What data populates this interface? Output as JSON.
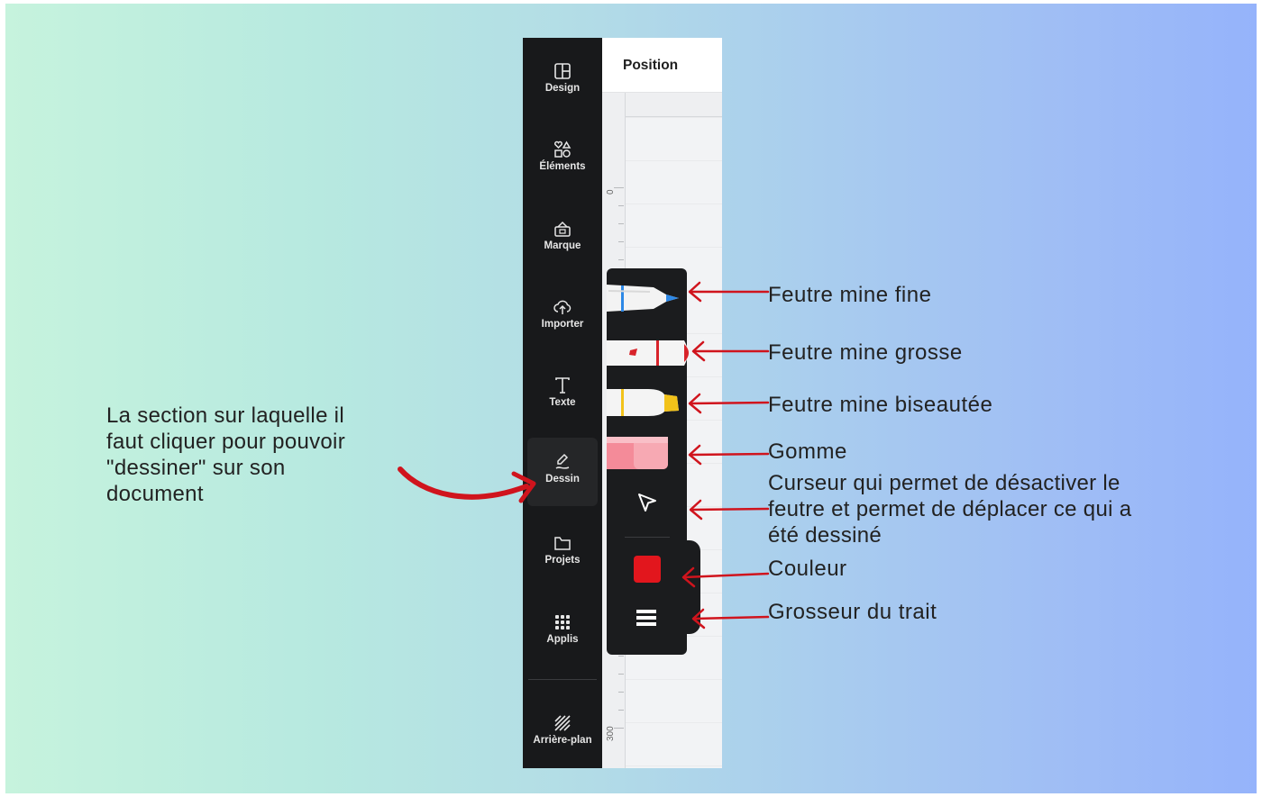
{
  "sidebar": {
    "items": [
      {
        "label": "Design",
        "icon": "layout-icon"
      },
      {
        "label": "Éléments",
        "icon": "shapes-icon"
      },
      {
        "label": "Marque",
        "icon": "brand-icon"
      },
      {
        "label": "Importer",
        "icon": "cloud-upload-icon"
      },
      {
        "label": "Texte",
        "icon": "text-icon"
      },
      {
        "label": "Dessin",
        "icon": "draw-icon",
        "active": true
      },
      {
        "label": "Projets",
        "icon": "folder-icon"
      },
      {
        "label": "Applis",
        "icon": "apps-grid-icon"
      },
      {
        "label": "Arrière-plan",
        "icon": "background-icon"
      }
    ]
  },
  "canvas": {
    "panel_title": "Position",
    "ruler_labels": [
      "0",
      "300"
    ]
  },
  "draw_toolbar": {
    "tools": [
      "fine-marker",
      "thick-marker",
      "highlighter",
      "eraser",
      "cursor"
    ],
    "current_color": "#e2161d",
    "stroke_icon": "line-weight-icon"
  },
  "annotations": {
    "left_note": [
      "La section sur laquelle il",
      "faut cliquer pour pouvoir",
      "\"dessiner\" sur son",
      "document"
    ],
    "fine": "Feutre mine fine",
    "thick": "Feutre mine grosse",
    "bevel": "Feutre mine biseautée",
    "eraser": "Gomme",
    "cursor": [
      "Curseur qui permet de désactiver le",
      "feutre et permet de déplacer ce qui a",
      "été dessiné"
    ],
    "color": "Couleur",
    "stroke": "Grosseur du trait",
    "arrow_color": "#d0141d"
  }
}
